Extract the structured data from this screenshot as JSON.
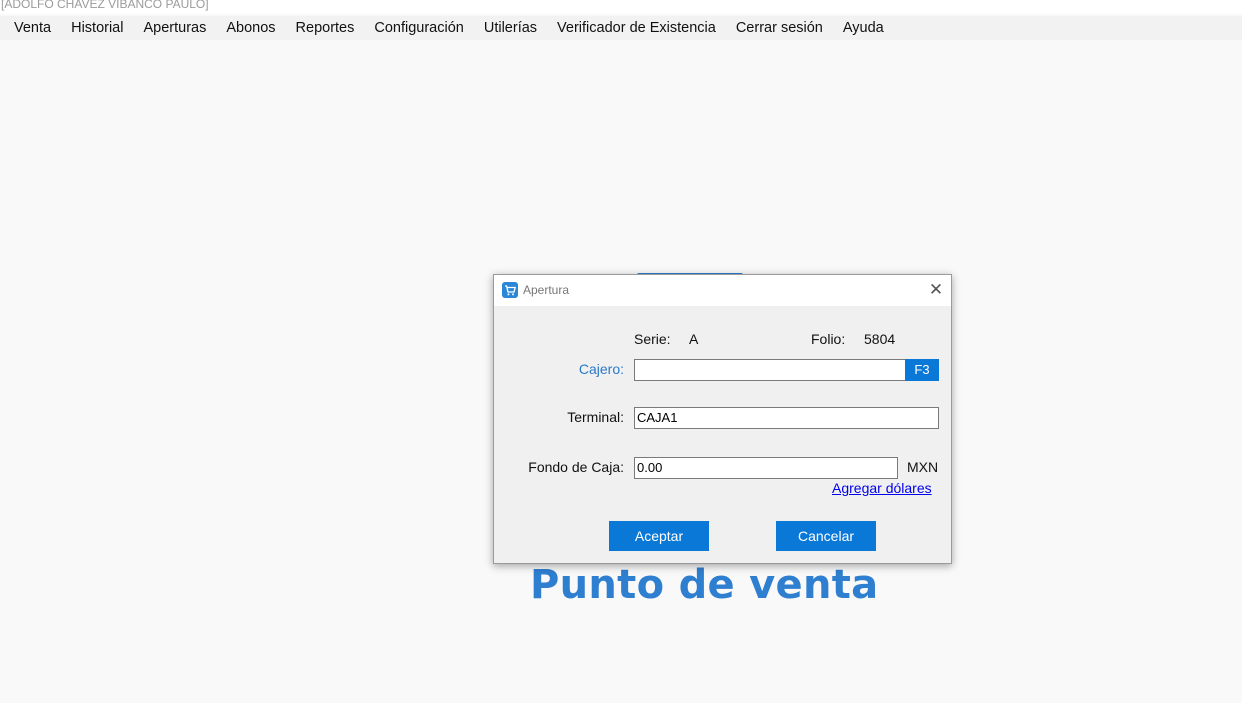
{
  "window": {
    "title": "[ADOLFO CHAVEZ VIBANCO PAULO]"
  },
  "menubar": {
    "items": [
      "Venta",
      "Historial",
      "Aperturas",
      "Abonos",
      "Reportes",
      "Configuración",
      "Utilerías",
      "Verificador de Existencia",
      "Cerrar sesión",
      "Ayuda"
    ]
  },
  "background": {
    "brand_text": "Punto de venta"
  },
  "dialog": {
    "title": "Apertura",
    "icon": "cart-icon",
    "close_icon": "close-icon",
    "serie_label": "Serie:",
    "serie_value": "A",
    "folio_label": "Folio:",
    "folio_value": "5804",
    "cajero_label": "Cajero:",
    "cajero_value": "",
    "f3_label": "F3",
    "terminal_label": "Terminal:",
    "terminal_value": "CAJA1",
    "fondo_label": "Fondo de Caja:",
    "fondo_value": "0.00",
    "currency": "MXN",
    "add_dollars_link": "Agregar dólares",
    "accept_label": "Aceptar",
    "cancel_label": "Cancelar"
  },
  "colors": {
    "accent": "#0a78d7",
    "brand": "#2f7fd0",
    "link": "#0000ee",
    "label_blue": "#2a79c8"
  }
}
